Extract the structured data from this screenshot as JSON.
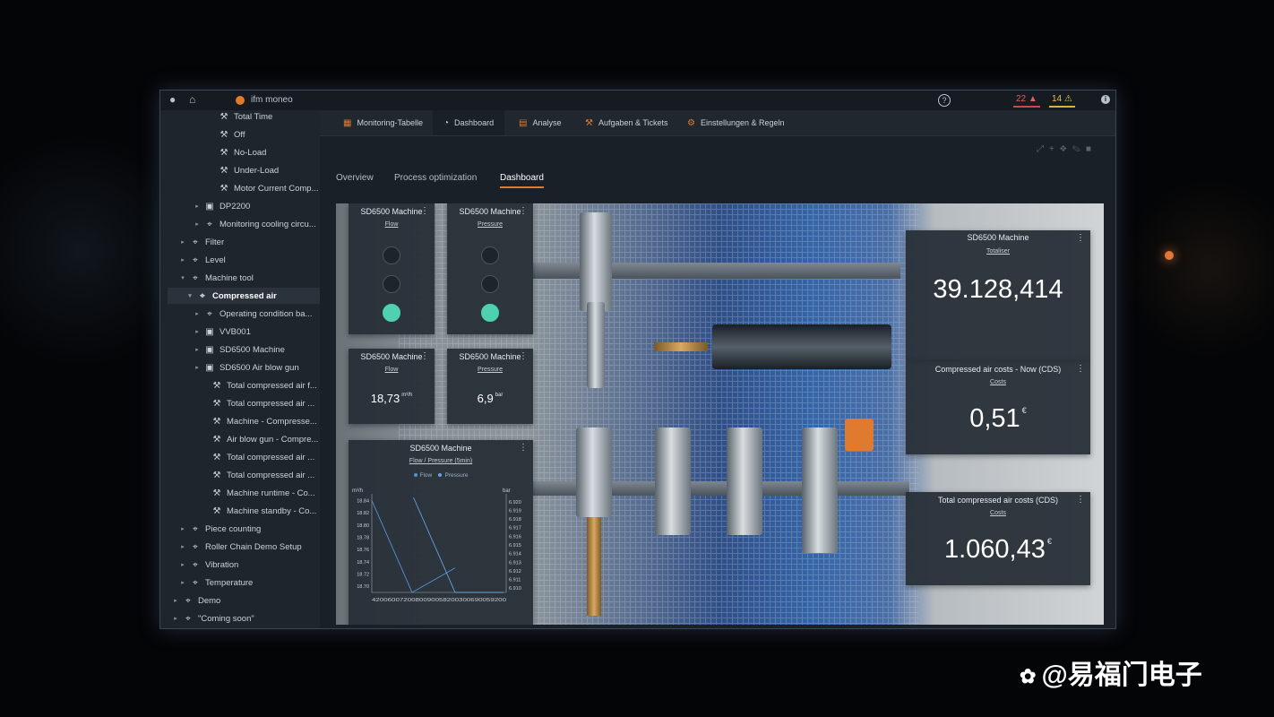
{
  "topbar": {
    "brand": "ifm moneo",
    "help": "?",
    "alarm_red": "22",
    "alarm_yellow": "14",
    "info": "i",
    "colors": {
      "brand": "#e07a2e",
      "red": "#d04545",
      "yellow": "#d6b33a"
    }
  },
  "sidebar": {
    "items": [
      {
        "label": "Total Time",
        "twisty": "",
        "icon": "sensor-icon"
      },
      {
        "label": "Off",
        "twisty": "",
        "icon": "sensor-icon"
      },
      {
        "label": "No-Load",
        "twisty": "",
        "icon": "sensor-icon"
      },
      {
        "label": "Under-Load",
        "twisty": "",
        "icon": "sensor-icon"
      },
      {
        "label": "Motor Current Comp...",
        "twisty": "",
        "icon": "sensor-icon"
      },
      {
        "label": "DP2200",
        "twisty": "▸",
        "icon": "device-icon"
      },
      {
        "label": "Monitoring cooling circu...",
        "twisty": "▸",
        "icon": "location-icon"
      },
      {
        "label": "Filter",
        "twisty": "▸",
        "icon": "location-icon"
      },
      {
        "label": "Level",
        "twisty": "▸",
        "icon": "location-icon"
      },
      {
        "label": "Machine tool",
        "twisty": "▾",
        "icon": "location-icon"
      },
      {
        "label": "Compressed air",
        "twisty": "▾",
        "icon": "location-icon"
      },
      {
        "label": "Operating condition ba...",
        "twisty": "▸",
        "icon": "location-icon"
      },
      {
        "label": "VVB001",
        "twisty": "▸",
        "icon": "device-icon"
      },
      {
        "label": "SD6500 Machine",
        "twisty": "▸",
        "icon": "device-icon"
      },
      {
        "label": "SD6500 Air blow gun",
        "twisty": "▸",
        "icon": "device-icon"
      },
      {
        "label": "Total compressed air f...",
        "twisty": "",
        "icon": "sensor-icon"
      },
      {
        "label": "Total compressed air ...",
        "twisty": "",
        "icon": "sensor-icon"
      },
      {
        "label": "Machine - Compresse...",
        "twisty": "",
        "icon": "sensor-icon"
      },
      {
        "label": "Air blow gun - Compre...",
        "twisty": "",
        "icon": "sensor-icon"
      },
      {
        "label": "Total compressed air ...",
        "twisty": "",
        "icon": "sensor-icon"
      },
      {
        "label": "Total compressed air ...",
        "twisty": "",
        "icon": "sensor-icon"
      },
      {
        "label": "Machine runtime - Co...",
        "twisty": "",
        "icon": "sensor-icon"
      },
      {
        "label": "Machine standby - Co...",
        "twisty": "",
        "icon": "sensor-icon"
      },
      {
        "label": "Piece counting",
        "twisty": "▸",
        "icon": "location-icon"
      },
      {
        "label": "Roller Chain Demo Setup",
        "twisty": "▸",
        "icon": "location-icon"
      },
      {
        "label": "Vibration",
        "twisty": "▸",
        "icon": "location-icon"
      },
      {
        "label": "Temperature",
        "twisty": "▸",
        "icon": "location-icon"
      },
      {
        "label": "Demo",
        "twisty": "▸",
        "icon": "location-icon"
      },
      {
        "label": "\"Coming soon\"",
        "twisty": "▸",
        "icon": "location-icon"
      }
    ]
  },
  "nav": {
    "tabs": [
      {
        "label": "Monitoring-Tabelle",
        "icon": "table-icon"
      },
      {
        "label": "Dashboard",
        "icon": "gauge-icon"
      },
      {
        "label": "Analyse",
        "icon": "chart-icon"
      },
      {
        "label": "Aufgaben & Tickets",
        "icon": "wrench-icon"
      },
      {
        "label": "Einstellungen & Regeln",
        "icon": "settings-icon"
      }
    ],
    "active": "Dashboard"
  },
  "subtabs": [
    "Overview",
    "Process optimization",
    "Dashboard"
  ],
  "widgets": {
    "flow_lamps": {
      "title": "SD6500 Machine",
      "subtitle": "Flow",
      "active_lamp": 3
    },
    "pressure_lamps": {
      "title": "SD6500 Machine",
      "subtitle": "Pressure",
      "active_lamp": 3
    },
    "flow_value": {
      "title": "SD6500 Machine",
      "subtitle": "Flow",
      "value": "18,73",
      "unit": "m³/h"
    },
    "pressure_value": {
      "title": "SD6500 Machine",
      "subtitle": "Pressure",
      "value": "6,9",
      "unit": "bar"
    },
    "totaliser": {
      "title": "SD6500 Machine",
      "subtitle": "Totaliser",
      "value": "39.128,414"
    },
    "costs_now": {
      "title": "Compressed air costs - Now (CDS)",
      "subtitle": "Costs",
      "value": "0,51",
      "unit": "€"
    },
    "costs_total": {
      "title": "Total compressed air costs (CDS)",
      "subtitle": "Costs",
      "value": "1.060,43",
      "unit": "€"
    },
    "chart": {
      "title": "SD6500 Machine",
      "subtitle": "Flow / Pressure (5min)"
    },
    "colors": {
      "lamp_on": "#4fd0b0",
      "accent": "#e07a2e"
    }
  },
  "chart_data": {
    "type": "line",
    "title": "Flow / Pressure (5min)",
    "legend": [
      "Flow",
      "Pressure"
    ],
    "legend_placement": "top-center",
    "y_left_label": "m³/h",
    "y_right_label": "bar",
    "y_left_ticks": [
      "18.84",
      "18.82",
      "18.80",
      "18.78",
      "18.76",
      "18.74",
      "18.72",
      "18.70"
    ],
    "y_right_ticks": [
      "6.920",
      "6.919",
      "6.918",
      "6.917",
      "6.916",
      "6.915",
      "6.914",
      "6.913",
      "6.912",
      "6.911",
      "6.910"
    ],
    "y_left_range": [
      18.69,
      18.845
    ],
    "y_right_range": [
      6.9095,
      6.9205
    ],
    "x_ticks_text": "4200600720080090058200300690059200",
    "series": [
      {
        "name": "Flow",
        "x": [
          0,
          0.3,
          0.62
        ],
        "y": [
          18.84,
          18.69,
          18.73
        ]
      },
      {
        "name": "Pressure",
        "x": [
          0.31,
          0.62,
          0.98
        ],
        "y": [
          6.9205,
          6.9095,
          6.9095
        ]
      }
    ]
  },
  "watermark": "@易福门电子"
}
